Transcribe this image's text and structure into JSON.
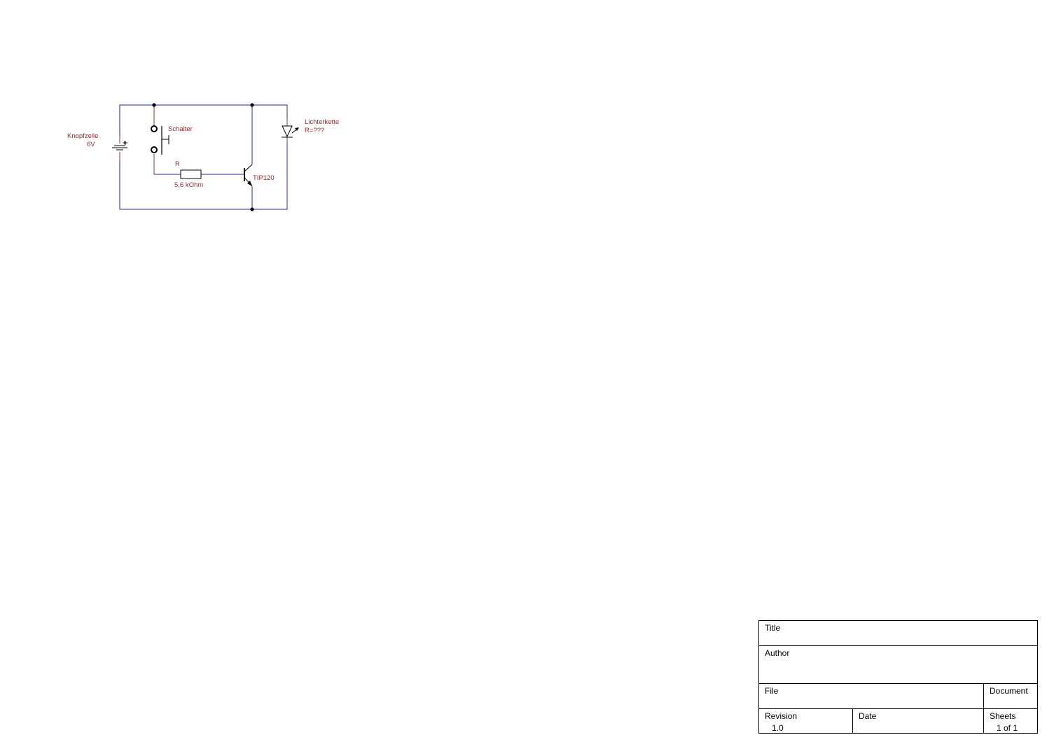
{
  "schematic": {
    "wire_color": "#1f1fc8",
    "label_color": "#a0282a",
    "components": {
      "battery": {
        "name": "Knopfzelle",
        "value": "6V",
        "polarity": "+"
      },
      "switch": {
        "name": "Schalter"
      },
      "resistor": {
        "name": "R",
        "value": "5,6 kOhm"
      },
      "transistor": {
        "name": "TIP120"
      },
      "led": {
        "name": "Lichterkette",
        "value": "R=???"
      }
    }
  },
  "title_block": {
    "title_label": "Title",
    "title_value": "",
    "author_label": "Author",
    "author_value": "",
    "file_label": "File",
    "file_value": "",
    "document_label": "Document",
    "document_value": "",
    "revision_label": "Revision",
    "revision_value": "1.0",
    "date_label": "Date",
    "date_value": "",
    "sheets_label": "Sheets",
    "sheets_value": "1 of 1"
  }
}
